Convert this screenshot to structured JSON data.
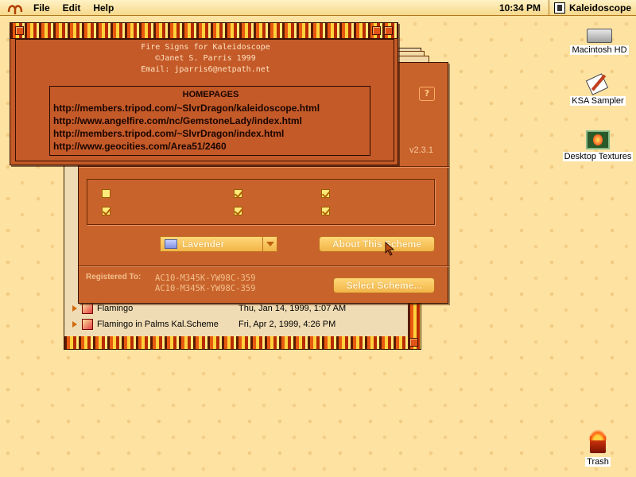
{
  "menubar": {
    "items": [
      "File",
      "Edit",
      "Help"
    ],
    "clock": "10:34 PM",
    "active_app": "Kaleidoscope",
    "apple_icon": "aries-apple-icon"
  },
  "about_window": {
    "credits": [
      "Fire Signs for Kaleidoscope",
      "©Janet S. Parris 1999",
      "Email: jparris6@netpath.net"
    ],
    "homepages_title": "HOMEPAGES",
    "urls": [
      "http://members.tripod.com/~SlvrDragon/kaleidoscope.html",
      "http://www.angelfire.com/nc/GemstoneLady/index.html",
      "http://members.tripod.com/~SlvrDragon/index.html",
      "http://www.geocities.com/Area51/2460"
    ]
  },
  "control_panel": {
    "version": "v2.3.1",
    "help_glyph": "?",
    "checkboxes": [
      {
        "checked": false
      },
      {
        "checked": true
      },
      {
        "checked": true
      },
      {
        "checked": true
      },
      {
        "checked": true
      },
      {
        "checked": true
      }
    ],
    "scheme_popup": "Lavender",
    "about_scheme_button": "About This Scheme",
    "registered_label": "Registered To:",
    "registration_codes": [
      "AC10-M345K-YW98C-359",
      "AC10-M345K-YW98C-359"
    ],
    "select_scheme_button": "Select Scheme..."
  },
  "finder_window": {
    "rows": [
      {
        "name": "Flamingo",
        "date": "Thu, Jan 14, 1999, 1:07 AM"
      },
      {
        "name": "Flamingo in Palms Kal.Scheme",
        "date": "Fri, Apr 2, 1999, 4:26 PM"
      }
    ]
  },
  "desktop": {
    "icons": [
      {
        "label": "Macintosh HD",
        "icon": "hard-disk-icon"
      },
      {
        "label": "KSA Sampler",
        "icon": "ksa-sampler-icon"
      },
      {
        "label": "Desktop Textures",
        "icon": "desktop-textures-icon"
      },
      {
        "label": "Trash",
        "icon": "flaming-trash-icon"
      }
    ]
  },
  "colors": {
    "desktop": "#fde2a2",
    "panel": "#c9632c",
    "about_bg": "#c45a28",
    "button": "#f2b448"
  }
}
